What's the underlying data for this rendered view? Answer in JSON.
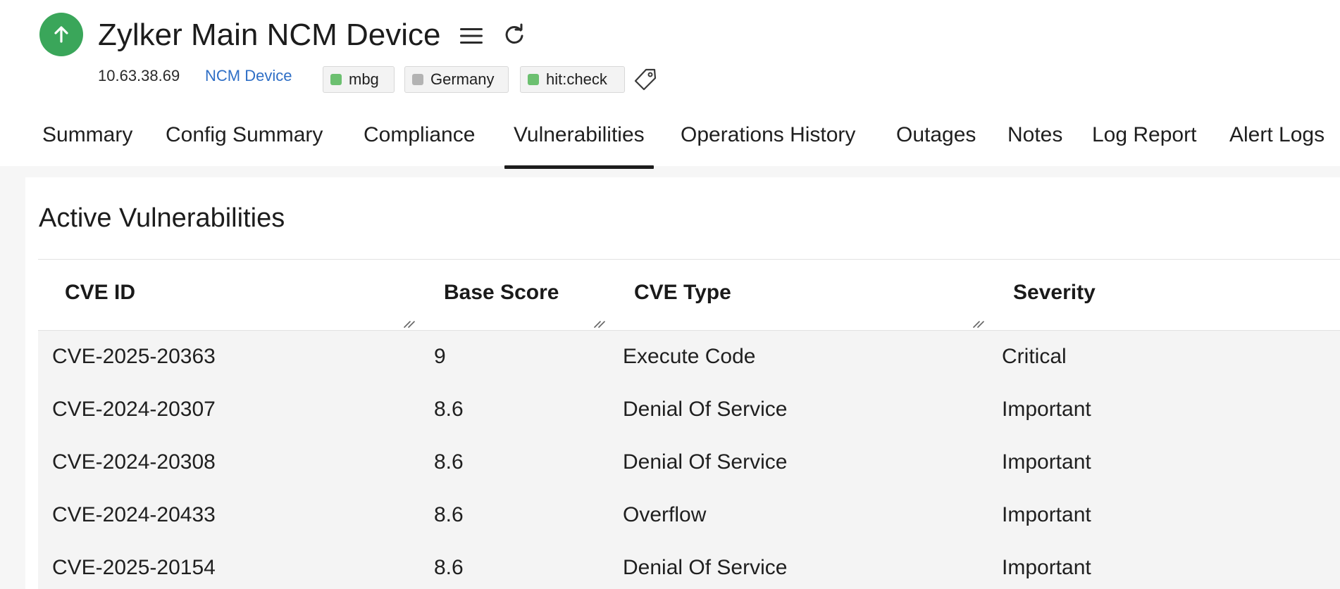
{
  "device": {
    "title": "Zylker Main NCM Device",
    "ip": "10.63.38.69",
    "type": "NCM Device",
    "status_color": "#3aa65a",
    "tags": [
      {
        "label": "mbg",
        "color": "#6cc070"
      },
      {
        "label": "Germany",
        "color": "#b3b3b3"
      },
      {
        "label": "hit:check",
        "color": "#6cc070"
      }
    ]
  },
  "icons": {
    "status": "arrow-up-icon",
    "menu": "hamburger-menu-icon",
    "refresh": "refresh-icon",
    "tag": "tag-icon"
  },
  "tabs": [
    {
      "label": "Summary"
    },
    {
      "label": "Config Summary"
    },
    {
      "label": "Compliance"
    },
    {
      "label": "Vulnerabilities",
      "active": true
    },
    {
      "label": "Operations History"
    },
    {
      "label": "Outages"
    },
    {
      "label": "Notes"
    },
    {
      "label": "Log Report"
    },
    {
      "label": "Alert Logs"
    }
  ],
  "section": {
    "title": "Active Vulnerabilities"
  },
  "table": {
    "columns": [
      "CVE ID",
      "Base Score",
      "CVE Type",
      "Severity"
    ],
    "rows": [
      {
        "cve_id": "CVE-2025-20363",
        "base_score": "9",
        "cve_type": "Execute Code",
        "severity": "Critical"
      },
      {
        "cve_id": "CVE-2024-20307",
        "base_score": "8.6",
        "cve_type": "Denial Of Service",
        "severity": "Important"
      },
      {
        "cve_id": "CVE-2024-20308",
        "base_score": "8.6",
        "cve_type": "Denial Of Service",
        "severity": "Important"
      },
      {
        "cve_id": "CVE-2024-20433",
        "base_score": "8.6",
        "cve_type": "Overflow",
        "severity": "Important"
      },
      {
        "cve_id": "CVE-2025-20154",
        "base_score": "8.6",
        "cve_type": "Denial Of Service",
        "severity": "Important"
      }
    ]
  }
}
